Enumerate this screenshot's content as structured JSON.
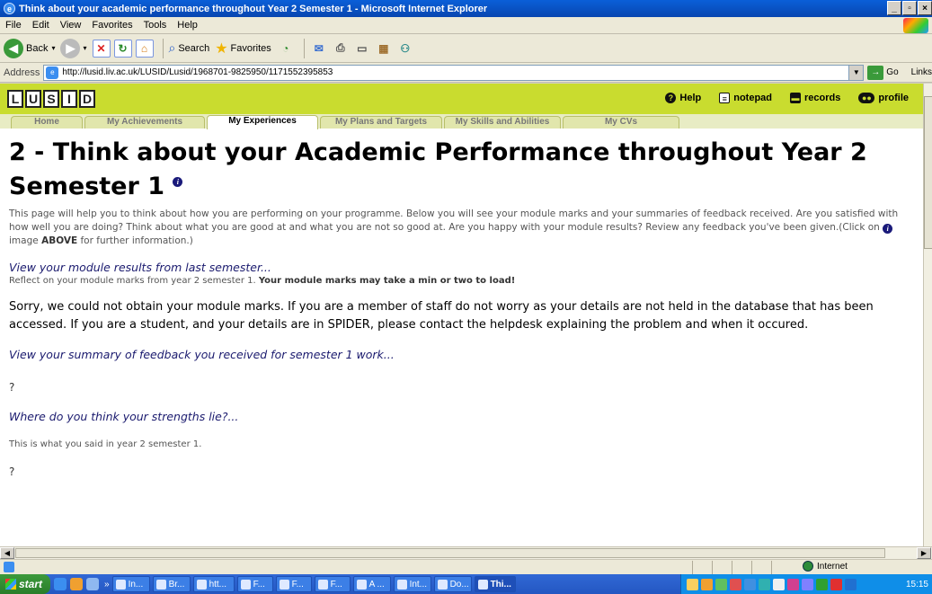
{
  "window": {
    "title": "Think about your academic performance throughout Year 2 Semester 1 - Microsoft Internet Explorer"
  },
  "menu": [
    "File",
    "Edit",
    "View",
    "Favorites",
    "Tools",
    "Help"
  ],
  "toolbar": {
    "back": "Back",
    "search": "Search",
    "favorites": "Favorites"
  },
  "address": {
    "label": "Address",
    "url": "http://lusid.liv.ac.uk/LUSID/Lusid/1968701-9825950/1171552395853",
    "go": "Go",
    "links": "Links"
  },
  "site": {
    "logo_letters": [
      "L",
      "U",
      "S",
      "I",
      "D"
    ],
    "header_links": {
      "help": "Help",
      "notepad": "notepad",
      "records": "records",
      "profile": "profile"
    },
    "tabs": [
      "Home",
      "My Achievements",
      "My Experiences",
      "My Plans and Targets",
      "My Skills and Abilities",
      "My CVs"
    ],
    "active_tab": "My Experiences",
    "brand_color": "#c9dc2f"
  },
  "page": {
    "title": "2 - Think about your Academic Performance throughout Year 2 Semester 1",
    "intro_before": "This page will help you to think about how you are performing on your programme. Below you will see your module marks and your summaries of feedback received. Are you satisfied with how well you are doing? Think about what you are good at and what you are not so good at. Are you happy with your module results? Review any feedback you've been given.(Click on",
    "intro_image_word": "image",
    "intro_above": "ABOVE",
    "intro_after": "for further information.)",
    "section1_heading": "View your module results from last semester...",
    "section1_text": "Reflect on your module marks from year 2 semester 1.",
    "section1_bold": "Your module marks may take a min or two to load!",
    "error_message": "Sorry, we could not obtain your module marks. If you are a member of staff do not worry as your details are not held in the database that has been accessed. If you are a student, and your details are in SPIDER, please contact the helpdesk explaining the problem and when it occured.",
    "section2_heading": "View your summary of feedback you received for semester 1 work...",
    "section2_value": "?",
    "section3_heading": "Where do you think your strengths lie?...",
    "section3_said": "This is what you said in year 2 semester 1.",
    "section3_value": "?"
  },
  "statusbar": {
    "zone": "Internet"
  },
  "taskbar": {
    "start": "start",
    "buttons": [
      "In...",
      "Br...",
      "htt...",
      "F...",
      "F...",
      "F...",
      "A ...",
      "Int...",
      "Do...",
      "Thi..."
    ],
    "active_button": "Thi...",
    "clock": "15:15"
  }
}
